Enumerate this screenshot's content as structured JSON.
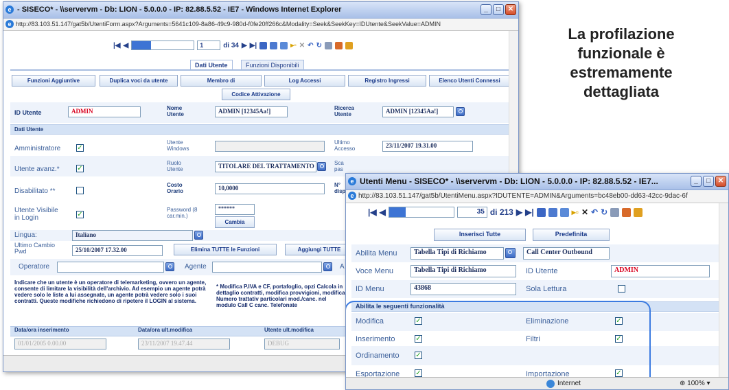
{
  "heading": {
    "line1": "La profilazione",
    "line2": "funzionale è",
    "line3": "estremamente",
    "line4": "dettagliata"
  },
  "back": {
    "title": "- SISECO* - \\\\servervm - Db: LION - 5.0.0.0 - IP: 82.88.5.52 - IE7 - Windows Internet Explorer",
    "url": "http://83.103.51.147/gat5b/UtentiForm.aspx?Arguments=5641c109-8a86-49c9-980d-f0fe20ff266c&Modality=Seek&SeekKey=IDUtente&SeekValue=ADMIN",
    "nav": {
      "page": "1",
      "total": "di 34"
    },
    "tabs": [
      "Dati Utente",
      "Funzioni Disponibili"
    ],
    "buttons": [
      "Funzioni Aggiuntive",
      "Duplica voci da utente",
      "Membro di",
      "Log Accessi",
      "Registro Ingressi",
      "Elenco Utenti Connessi",
      "Codice Attivazione"
    ],
    "id_utente_label": "ID Utente",
    "id_utente_value": "ADMIN",
    "nome_label": "Nome Utente",
    "nome_value": "ADMIN [12345Aa!]",
    "ricerca_label": "Ricerca Utente",
    "ricerca_value": "ADMIN [12345Aa!]",
    "section": "Dati Utente",
    "amministratore": "Amministratore",
    "utente_windows": "Utente Windows",
    "ultimo_accesso": "Ultimo Accesso",
    "ultimo_accesso_value": "23/11/2007 19.31.00",
    "utente_avanz": "Utente avanz.*",
    "ruolo": "Ruolo Utente",
    "ruolo_value": "TITOLARE DEL TRATTAMENTO",
    "scad": "Sca pas",
    "disabilitato": "Disabilitato **",
    "costo": "Costo Orario",
    "costo_value": "10,0000",
    "ndisp": "N° disp",
    "visibile": "Utente Visibile in Login",
    "password": "Password (8 car.min.)",
    "password_value": "******",
    "cambia": "Cambia",
    "lingua": "Lingua:",
    "lingua_value": "Italiano",
    "ultimo_cambio": "Ultimo Cambio Pwd",
    "ultimo_cambio_value": "25/10/2007 17.32.00",
    "elimina": "Elimina TUTTE le Funzioni",
    "aggiungi": "Aggiungi TUTTE",
    "operatore": "Operatore",
    "agente": "Agente",
    "a_label": "A",
    "note_left": "Indicare che un utente è un operatore di telemarketing, ovvero un agente, consente di limitare la visibilità dell'archivio. Ad esempio un agente potrà vedere solo le liste a lui assegnate, un agente potrà vedere solo i suoi contratti. Queste modifiche richiedono di ripetere il LOGIN al sistema.",
    "note_right": "* Modifica P.IVA e CF, portafoglio, opzi Calcola in dettaglio contratti, modifica provvigioni, modifica Numero trattativ particolari mod./canc. nel modulo Call C canc. Telefonate",
    "data_ins_label": "Data/ora inserimento",
    "data_ins_value": "01/01/2005 0.00.00",
    "data_mod_label": "Data/ora ult.modifica",
    "data_mod_value": "23/11/2007 19.47.44",
    "utente_mod_label": "Utente ult.modifica",
    "utente_mod_value": "DEBUG"
  },
  "front": {
    "title": "Utenti Menu - SISECO* - \\\\servervm - Db: LION - 5.0.0.0 - IP: 82.88.5.52 - IE7...",
    "url": "http://83.103.51.147/gat5b/UtentiMenu.aspx?IDUTENTE=ADMIN&Arguments=bc48eb00-dd63-42cc-9dac-6f",
    "nav": {
      "page": "35",
      "total": "di 213"
    },
    "inserisci": "Inserisci Tutte",
    "predefinita": "Predefinita",
    "abilita_label": "Abilita Menu",
    "abilita_value": "Tabella Tipi di Richiamo",
    "callcenter": "Call Center Outbound",
    "voce_label": "Voce Menu",
    "voce_value": "Tabella Tipi di Richiamo",
    "id_utente_label": "ID Utente",
    "id_utente_value": "ADMIN",
    "id_menu_label": "ID Menu",
    "id_menu_value": "43868",
    "sola_lettura": "Sola Lettura",
    "section": "Abilita le seguenti funzionalità",
    "perms": [
      {
        "left": "Modifica",
        "right": "Eliminazione"
      },
      {
        "left": "Inserimento",
        "right": "Filtri"
      },
      {
        "left": "Ordinamento",
        "right": ""
      },
      {
        "left": "Esportazione",
        "right": "Importazione"
      }
    ],
    "status_internet": "Internet",
    "zoom": "100%"
  }
}
